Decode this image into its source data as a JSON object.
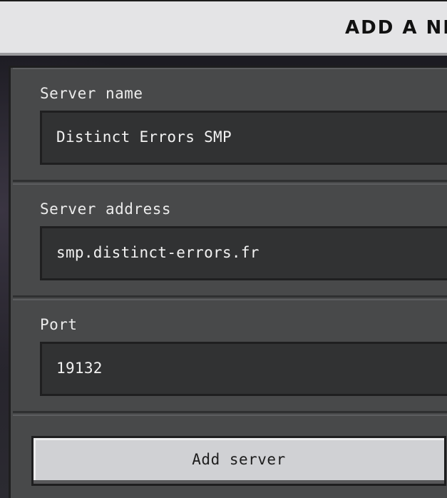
{
  "header": {
    "title": "ADD A NE"
  },
  "form": {
    "server_name": {
      "label": "Server name",
      "value": "Distinct Errors SMP"
    },
    "server_address": {
      "label": "Server address",
      "value": "smp.distinct-errors.fr"
    },
    "port": {
      "label": "Port",
      "value": "19132"
    },
    "submit_label": "Add server"
  },
  "colors": {
    "header_bg": "#e4e4e6",
    "panel_bg": "#48494a",
    "field_bg": "#313233",
    "button_bg": "#d0d1d4"
  }
}
